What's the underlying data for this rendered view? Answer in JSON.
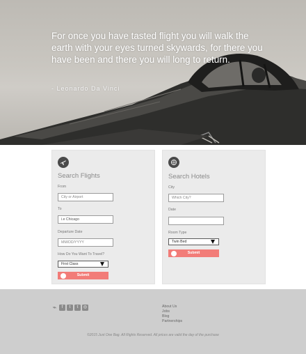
{
  "hero": {
    "quote": "For once you have tasted flight you will walk the earth with your eyes turned skywards, for there you have been and there you will long to return.",
    "author": "- Leonardo Da Vinci"
  },
  "flights": {
    "icon": "airplane-icon",
    "title": "Search Flights",
    "from_label": "From",
    "from_placeholder": "City or Airport",
    "to_label": "To",
    "to_value": "i.e Chicago",
    "date_label": "Departure Date",
    "date_placeholder": "MM/DD/YYYY",
    "class_label": "How Do You Want To Travel?",
    "class_selected": "First Class",
    "submit_label": "Submit"
  },
  "hotels": {
    "icon": "globe-icon",
    "title": "Search Hotels",
    "city_label": "City",
    "city_placeholder": "Which City?",
    "date_label": "Date",
    "date_value": "",
    "room_label": "Room Type",
    "room_selected": "Twin Bed",
    "submit_label": "Submit"
  },
  "footer": {
    "social": [
      "rss-icon",
      "facebook-icon",
      "twitter-icon",
      "tumblr-icon",
      "instagram-icon"
    ],
    "links": [
      "About Us",
      "Jobs",
      "Blog",
      "Partnerships"
    ],
    "copyright": "©2015 Just One Bag. All Rights Reserved. All prices are valid the day of the purchase"
  },
  "colors": {
    "accent": "#f27c78",
    "panel": "#ebebeb",
    "footer": "#cecece"
  }
}
